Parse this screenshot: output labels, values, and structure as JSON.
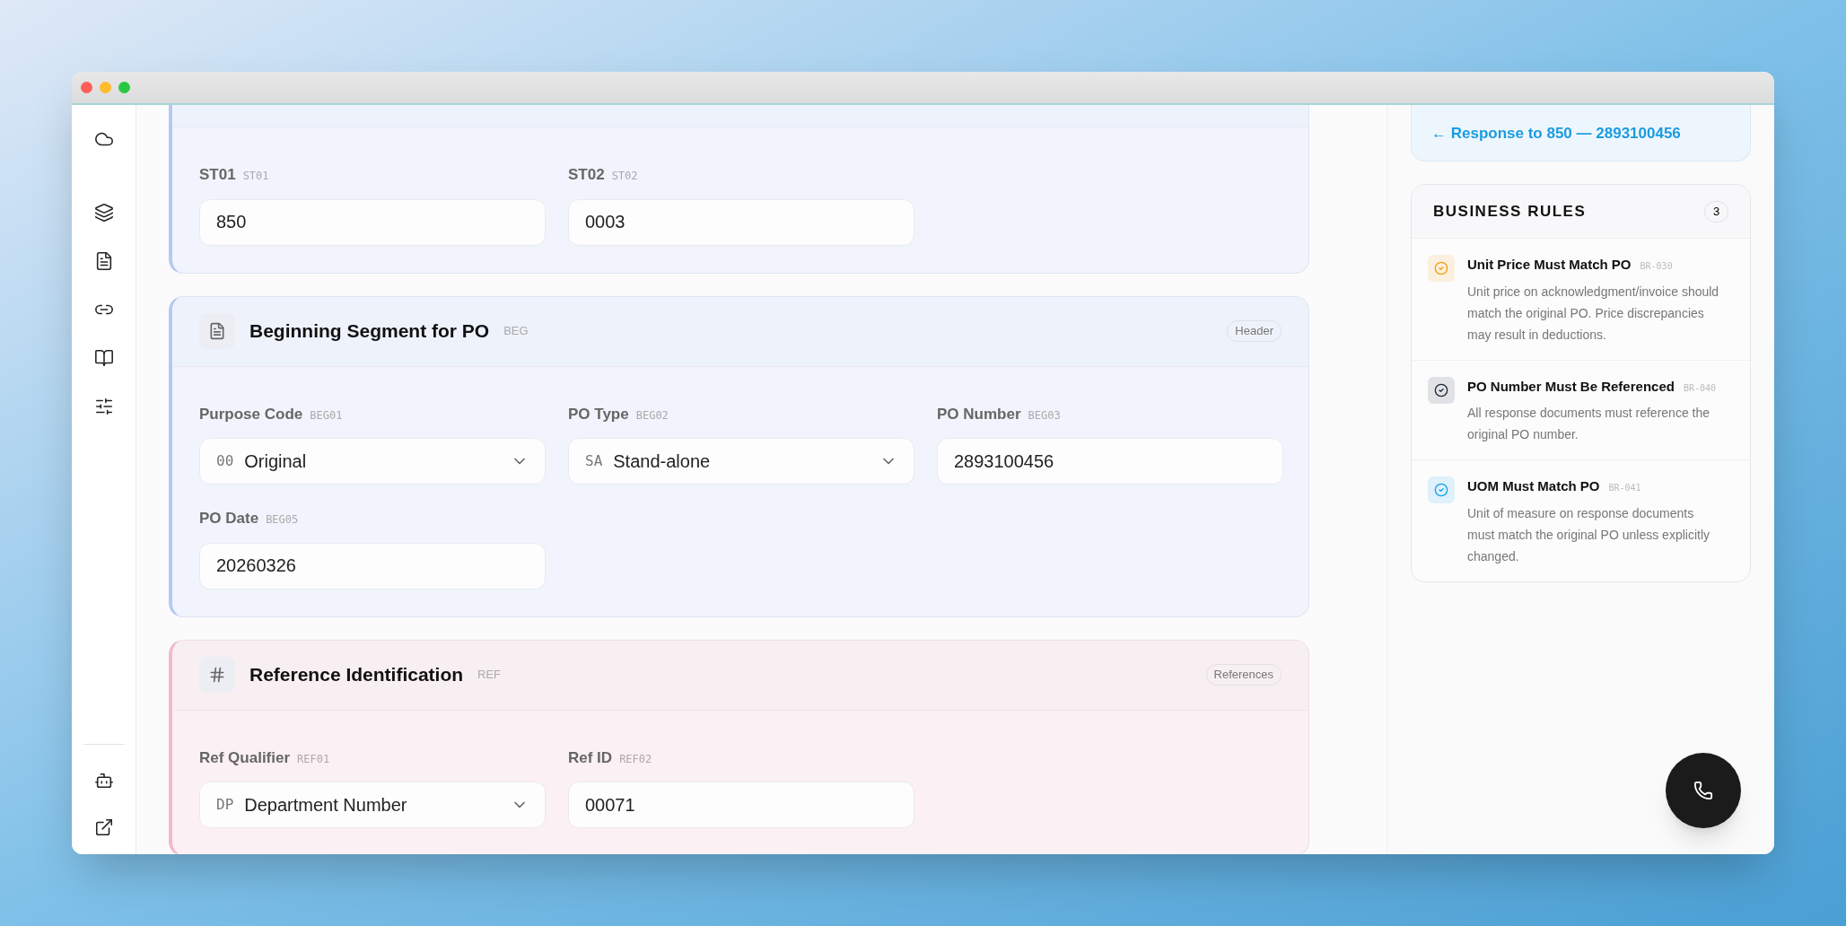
{
  "sidebar": {
    "items": [
      {
        "kind": "cloud"
      },
      {
        "kind": "layers"
      },
      {
        "kind": "file"
      },
      {
        "kind": "link"
      },
      {
        "kind": "book"
      },
      {
        "kind": "sliders"
      }
    ],
    "bottom_items": [
      {
        "kind": "bot"
      },
      {
        "kind": "external"
      }
    ]
  },
  "segments": [
    {
      "kind": "header",
      "fields": [
        {
          "kind": "text",
          "label": "ST01",
          "code": "ST01",
          "value": "850"
        },
        {
          "kind": "text",
          "label": "ST02",
          "code": "ST02",
          "value": "0003"
        }
      ]
    },
    {
      "kind": "header",
      "title": "Beginning Segment for PO",
      "code": "BEG",
      "badge": "Header",
      "fields": [
        {
          "kind": "select",
          "label": "Purpose Code",
          "code": "BEG01",
          "option_code": "00",
          "value": "Original"
        },
        {
          "kind": "select",
          "label": "PO Type",
          "code": "BEG02",
          "option_code": "SA",
          "value": "Stand-alone"
        },
        {
          "kind": "text",
          "label": "PO Number",
          "code": "BEG03",
          "value": "2893100456"
        },
        {
          "kind": "text",
          "label": "PO Date",
          "code": "BEG05",
          "value": "20260326"
        }
      ]
    },
    {
      "kind": "references",
      "title": "Reference Identification",
      "code": "REF",
      "badge": "References",
      "fields": [
        {
          "kind": "select",
          "label": "Ref Qualifier",
          "code": "REF01",
          "option_code": "DP",
          "value": "Department Number"
        },
        {
          "kind": "text",
          "label": "Ref ID",
          "code": "REF02",
          "value": "00071"
        }
      ]
    }
  ],
  "response_link": "← Response to 850 — 2893100456",
  "business_rules": {
    "title": "BUSINESS RULES",
    "count": "3",
    "rules": [
      {
        "title": "Unit Price Must Match PO",
        "code": "BR-030",
        "description": "Unit price on acknowledgment/invoice should match the original PO. Price discrepancies may result in deductions.",
        "color": "#f59e0b"
      },
      {
        "title": "PO Number Must Be Referenced",
        "code": "BR-040",
        "description": "All response documents must reference the original PO number.",
        "color": "#1f2937"
      },
      {
        "title": "UOM Must Match PO",
        "code": "BR-041",
        "description": "Unit of measure on response documents must match the original PO unless explicitly changed.",
        "color": "#0ea5e9"
      }
    ]
  }
}
